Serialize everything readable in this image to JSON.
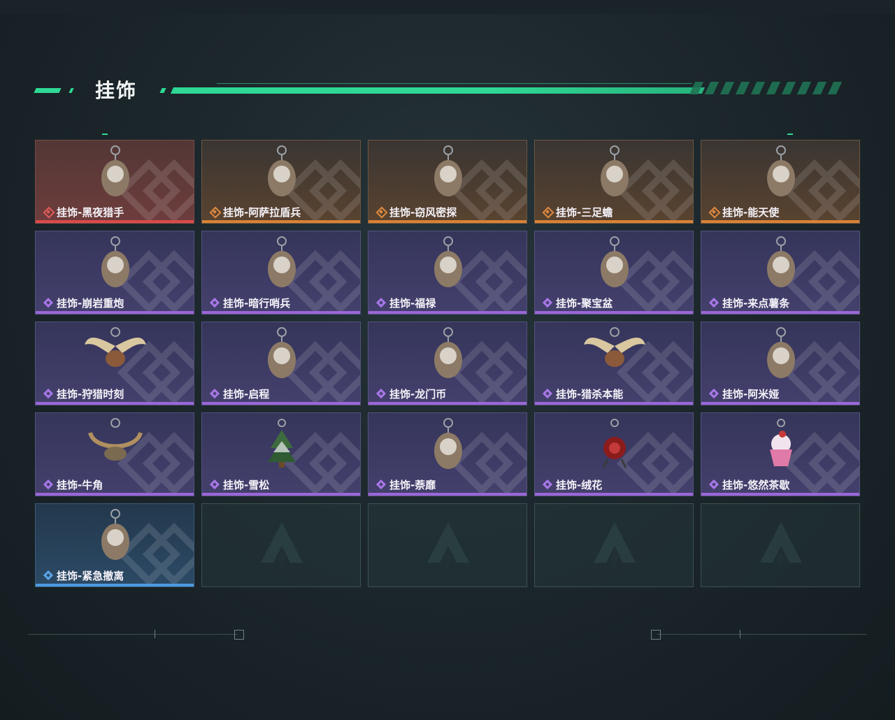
{
  "header": {
    "title": "挂饰"
  },
  "items": [
    {
      "label": "挂饰-黑夜猎手",
      "rarity": "red",
      "icon": "hanging-ornament-icon"
    },
    {
      "label": "挂饰-阿萨拉盾兵",
      "rarity": "orange",
      "icon": "hanging-ornament-icon"
    },
    {
      "label": "挂饰-窃风密探",
      "rarity": "orange",
      "icon": "hanging-ornament-icon"
    },
    {
      "label": "挂饰-三足蟾",
      "rarity": "orange",
      "icon": "hanging-ornament-icon"
    },
    {
      "label": "挂饰-能天使",
      "rarity": "orange",
      "icon": "hanging-ornament-icon"
    },
    {
      "label": "挂饰-崩岩重炮",
      "rarity": "purple",
      "icon": "hanging-ornament-icon"
    },
    {
      "label": "挂饰-暗行哨兵",
      "rarity": "purple",
      "icon": "hanging-ornament-icon"
    },
    {
      "label": "挂饰-福禄",
      "rarity": "purple",
      "icon": "hanging-ornament-icon"
    },
    {
      "label": "挂饰-聚宝盆",
      "rarity": "purple",
      "icon": "hanging-ornament-icon"
    },
    {
      "label": "挂饰-来点薯条",
      "rarity": "purple",
      "icon": "hanging-ornament-icon"
    },
    {
      "label": "挂饰-狩猎时刻",
      "rarity": "purple",
      "icon": "antler-ornament-icon"
    },
    {
      "label": "挂饰-启程",
      "rarity": "purple",
      "icon": "hanging-ornament-icon"
    },
    {
      "label": "挂饰-龙门币",
      "rarity": "purple",
      "icon": "hanging-ornament-icon"
    },
    {
      "label": "挂饰-猎杀本能",
      "rarity": "purple",
      "icon": "antler-ornament-icon"
    },
    {
      "label": "挂饰-阿米娅",
      "rarity": "purple",
      "icon": "hanging-ornament-icon"
    },
    {
      "label": "挂饰-牛角",
      "rarity": "purple",
      "icon": "horn-ornament-icon"
    },
    {
      "label": "挂饰-雪松",
      "rarity": "purple",
      "icon": "tree-ornament-icon"
    },
    {
      "label": "挂饰-萘靡",
      "rarity": "purple",
      "icon": "hanging-ornament-icon"
    },
    {
      "label": "挂饰-绒花",
      "rarity": "purple",
      "icon": "flower-ornament-icon"
    },
    {
      "label": "挂饰-悠然茶歇",
      "rarity": "purple",
      "icon": "cupcake-ornament-icon"
    },
    {
      "label": "挂饰-紧急撤离",
      "rarity": "blue",
      "icon": "hanging-ornament-icon"
    }
  ],
  "empty_slots": 4,
  "colors": {
    "accent": "#2fd895",
    "red": "#dd4a4a",
    "orange": "#d98236",
    "purple": "#9b66d8",
    "blue": "#4c9ae0"
  }
}
